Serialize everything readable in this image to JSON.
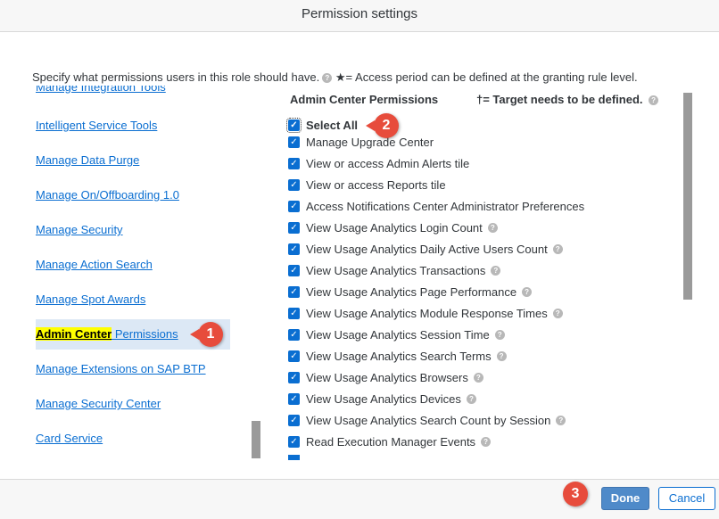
{
  "dialog": {
    "title": "Permission settings"
  },
  "intro": {
    "text": "Specify what permissions users in this role should have.",
    "star_note": "★= Access period can be defined at the granting rule level."
  },
  "left_nav": {
    "items": [
      {
        "label": "Manage Integration Tools"
      },
      {
        "label": "Intelligent Service Tools"
      },
      {
        "label": "Manage Data Purge"
      },
      {
        "label": "Manage On/Offboarding 1.0"
      },
      {
        "label": "Manage Security"
      },
      {
        "label": "Manage Action Search"
      },
      {
        "label": "Manage Spot Awards"
      },
      {
        "label_highlight": "Admin Center",
        "label_rest": " Permissions"
      },
      {
        "label": "Manage Extensions on SAP BTP"
      },
      {
        "label": "Manage Security Center"
      },
      {
        "label": "Card Service"
      }
    ]
  },
  "permissions": {
    "heading": "Admin Center Permissions",
    "target_note": "†= Target needs to be defined.",
    "select_all": "Select All",
    "items": [
      {
        "label": "Manage Upgrade Center",
        "checked": true,
        "help": false
      },
      {
        "label": "View or access Admin Alerts tile",
        "checked": true,
        "help": false
      },
      {
        "label": "View or access Reports tile",
        "checked": true,
        "help": false
      },
      {
        "label": "Access Notifications Center Administrator Preferences",
        "checked": true,
        "help": false
      },
      {
        "label": "View Usage Analytics Login Count",
        "checked": true,
        "help": true
      },
      {
        "label": "View Usage Analytics Daily Active Users Count",
        "checked": true,
        "help": true
      },
      {
        "label": "View Usage Analytics Transactions",
        "checked": true,
        "help": true
      },
      {
        "label": "View Usage Analytics Page Performance",
        "checked": true,
        "help": true
      },
      {
        "label": "View Usage Analytics Module Response Times",
        "checked": true,
        "help": true
      },
      {
        "label": "View Usage Analytics Session Time",
        "checked": true,
        "help": true
      },
      {
        "label": "View Usage Analytics Search Terms",
        "checked": true,
        "help": true
      },
      {
        "label": "View Usage Analytics Browsers",
        "checked": true,
        "help": true
      },
      {
        "label": "View Usage Analytics Devices",
        "checked": true,
        "help": true
      },
      {
        "label": "View Usage Analytics Search Count by Session",
        "checked": true,
        "help": true
      },
      {
        "label": "Read Execution Manager Events",
        "checked": true,
        "help": true
      }
    ]
  },
  "markers": {
    "m1": "1",
    "m2": "2",
    "m3": "3"
  },
  "footer": {
    "done": "Done",
    "cancel": "Cancel"
  },
  "colors": {
    "link": "#0a6ed1",
    "checkbox": "#0a6ed1",
    "marker": "#e74c3c",
    "highlight": "#ffff00",
    "done_button": "#4f8ac9"
  },
  "icons": {
    "checkbox": "checkmark-icon",
    "help": "question-mark-icon"
  }
}
